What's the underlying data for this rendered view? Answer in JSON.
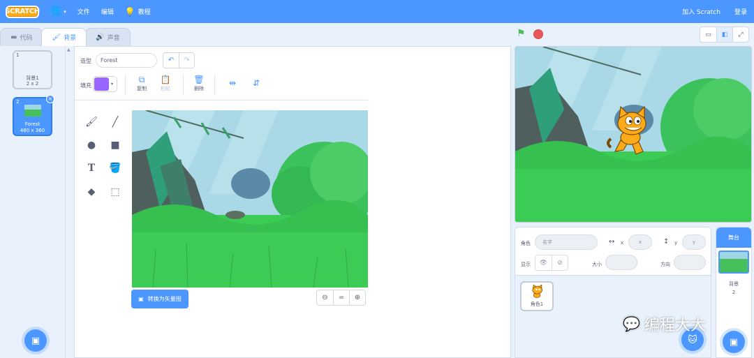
{
  "menubar": {
    "logo_text": "SCRATCH",
    "items": [
      "文件",
      "编辑"
    ],
    "tutorials": "教程",
    "join": "加入 Scratch",
    "signin": "登录"
  },
  "tabs": [
    {
      "label": "代码",
      "icon": "code-icon"
    },
    {
      "label": "背景",
      "icon": "brush-icon"
    },
    {
      "label": "声音",
      "icon": "speaker-icon"
    }
  ],
  "costumes": [
    {
      "number": "1",
      "name": "背景1",
      "size": "2 x 2"
    },
    {
      "number": "2",
      "name": "Forest",
      "size": "480 x 360"
    }
  ],
  "paint_editor": {
    "costume_label": "造型",
    "costume_name": "Forest",
    "fill_label": "填充",
    "fill_color": "#9966ff",
    "copy": "复制",
    "paste": "粘贴",
    "delete": "删除",
    "convert_button": "转换为矢量图"
  },
  "sprite_info": {
    "sprite_label": "角色",
    "name_placeholder": "名字",
    "x_label": "x",
    "x_placeholder": "x",
    "y_label": "y",
    "y_placeholder": "y",
    "show_label": "显示",
    "size_label": "大小",
    "direction_label": "方向"
  },
  "sprites": [
    {
      "name": "角色1"
    }
  ],
  "stage_target": {
    "header": "舞台",
    "label": "背景",
    "count": "2"
  },
  "watermark": "编程大大",
  "colors": {
    "accent": "#4c97ff",
    "flag": "#4cbf56",
    "stop": "#ec5959",
    "scratch_orange": "#ffab19"
  }
}
